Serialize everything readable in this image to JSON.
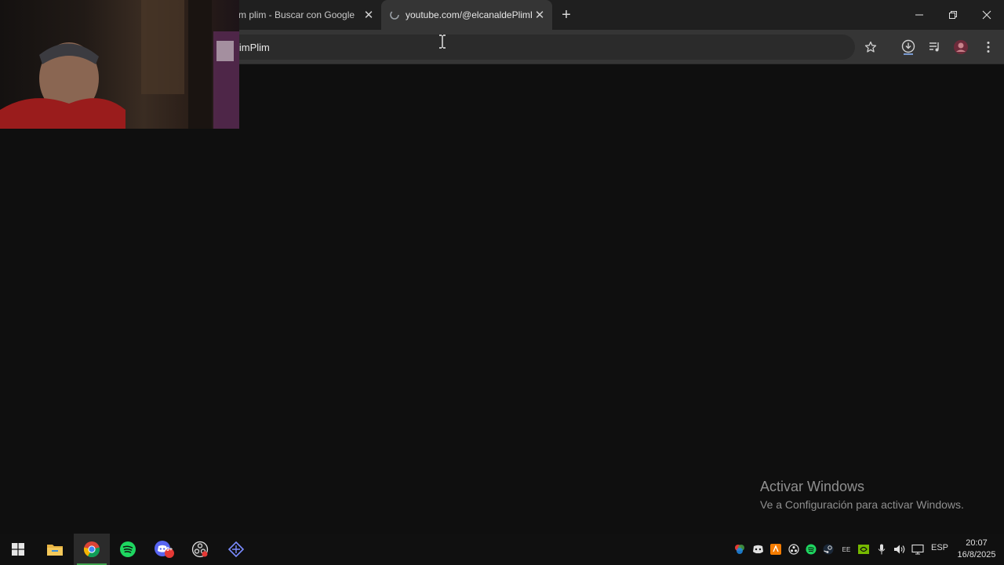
{
  "browser": {
    "tabs": [
      {
        "title": "m plim - Buscar con Google",
        "active": false
      },
      {
        "title": "youtube.com/@elcanaldePlimPlim",
        "active": true
      }
    ],
    "omnibox_text": "limPlim"
  },
  "page": {
    "watermark_line1": "Activar Windows",
    "watermark_line2": "Ve a Configuración para activar Windows."
  },
  "taskbar": {
    "apps": [
      "start-icon",
      "file-explorer-icon",
      "chrome-icon",
      "spotify-icon",
      "discord-icon",
      "obs-icon",
      "app-icon"
    ],
    "discord_badge": "9+",
    "tray_ime": "EE",
    "language": "ESP",
    "time": "20:07",
    "date": "16/8/2025"
  },
  "colors": {
    "spotify": "#1ed760",
    "discord": "#5865f2",
    "accent": "#3fa34d"
  }
}
